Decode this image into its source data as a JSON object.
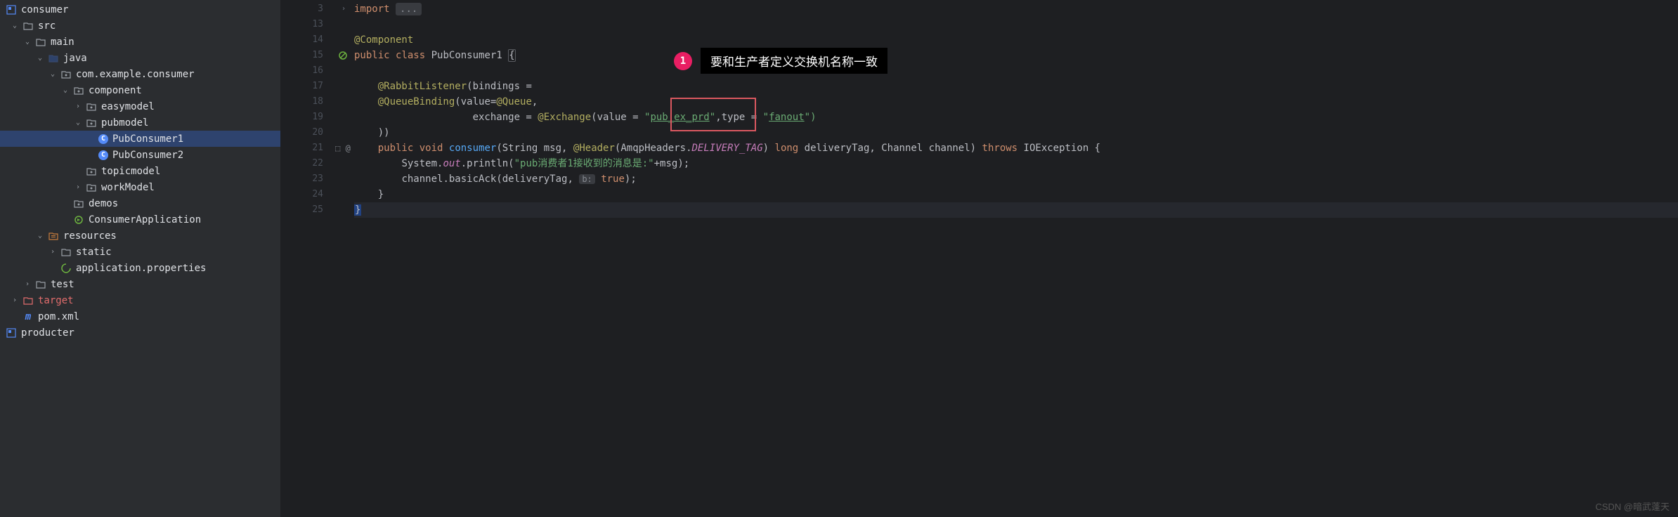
{
  "tree": {
    "consumer": "consumer",
    "src": "src",
    "main": "main",
    "java": "java",
    "pkg_consumer": "com.example.consumer",
    "component": "component",
    "easymodel": "easymodel",
    "pubmodel": "pubmodel",
    "pubconsumer1": "PubConsumer1",
    "pubconsumer2": "PubConsumer2",
    "topicmodel": "topicmodel",
    "workmodel": "workModel",
    "demos": "demos",
    "consumer_app": "ConsumerApplication",
    "resources": "resources",
    "static": "static",
    "app_props": "application.properties",
    "test": "test",
    "target": "target",
    "pom": "pom.xml",
    "producter": "producter"
  },
  "gutter": {
    "lines": [
      "3",
      "13",
      "14",
      "15",
      "16",
      "17",
      "18",
      "19",
      "20",
      "21",
      "22",
      "23",
      "24",
      "25"
    ]
  },
  "code": {
    "l3_import": "import",
    "l3_dots": "...",
    "l14": "@Component",
    "l15_public": "public",
    "l15_class": "class",
    "l15_name": "PubConsumer1",
    "l15_brace": "{",
    "l17": "@RabbitListener",
    "l17_args": "(bindings =",
    "l18": "@QueueBinding",
    "l18_args1": "(value=",
    "l18_queue": "@Queue",
    "l18_comma": ",",
    "l19_exchange": "exchange = ",
    "l19_exch_ann": "@Exchange",
    "l19_value": "(value = ",
    "l19_str": "\"",
    "l19_str_val": "pub_ex_prd",
    "l19_str2": "\"",
    "l19_type": ",type = ",
    "l19_fanout_q": "\"",
    "l19_fanout": "fanout",
    "l19_close": "\")",
    "l20": "))",
    "l21_public": "public",
    "l21_void": "void",
    "l21_method": "consumer",
    "l21_sig1": "(String msg, ",
    "l21_header": "@Header",
    "l21_sig2": "(AmqpHeaders.",
    "l21_delivery": "DELIVERY_TAG",
    "l21_sig3": ") ",
    "l21_long": "long",
    "l21_sig4": " deliveryTag, Channel channel) ",
    "l21_throws": "throws",
    "l21_ioe": " IOException {",
    "l22_sys": "System.",
    "l22_out": "out",
    "l22_print": ".println(",
    "l22_str": "\"pub消费者1接收到的消息是:\"",
    "l22_end": "+msg);",
    "l23_chan": "channel.basicAck(deliveryTag, ",
    "l23_hint": "b:",
    "l23_true": "true",
    "l23_end": ");",
    "l24": "}",
    "l25": "}"
  },
  "annotation": {
    "number": "1",
    "text": "要和生产者定义交换机名称一致"
  },
  "watermark": "CSDN @暗武蓬天"
}
